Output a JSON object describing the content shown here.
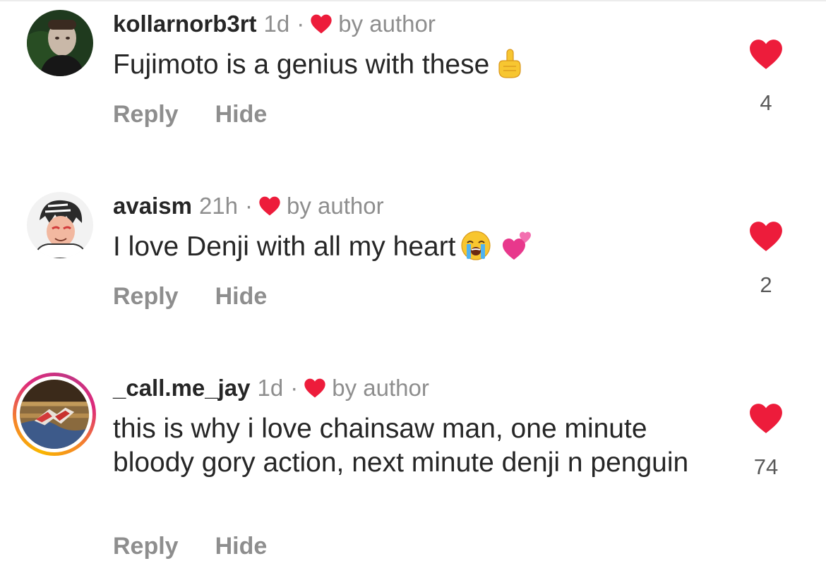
{
  "colors": {
    "heart": "#ed1c3b",
    "text": "#262626",
    "muted": "#8e8e8e"
  },
  "comments": [
    {
      "username": "kollarnorb3rt",
      "time": "1d",
      "separator": "·",
      "liked_by_author": "by author",
      "text": "Fujimoto is a genius with these",
      "emojis": [
        "index-pointing-up-emoji"
      ],
      "reply_label": "Reply",
      "hide_label": "Hide",
      "like_count": "4"
    },
    {
      "username": "avaism",
      "time": "21h",
      "separator": "·",
      "liked_by_author": "by author",
      "text": "I love Denji with all my heart",
      "emojis": [
        "loudly-crying-face-emoji",
        "two-hearts-emoji"
      ],
      "reply_label": "Reply",
      "hide_label": "Hide",
      "like_count": "2"
    },
    {
      "username": "_call.me_jay",
      "time": "1d",
      "separator": "·",
      "liked_by_author": "by author",
      "text": "this is why i love chainsaw man, one minute bloody gory action, next minute denji n penguin",
      "emojis": [],
      "reply_label": "Reply",
      "hide_label": "Hide",
      "like_count": "74"
    }
  ]
}
